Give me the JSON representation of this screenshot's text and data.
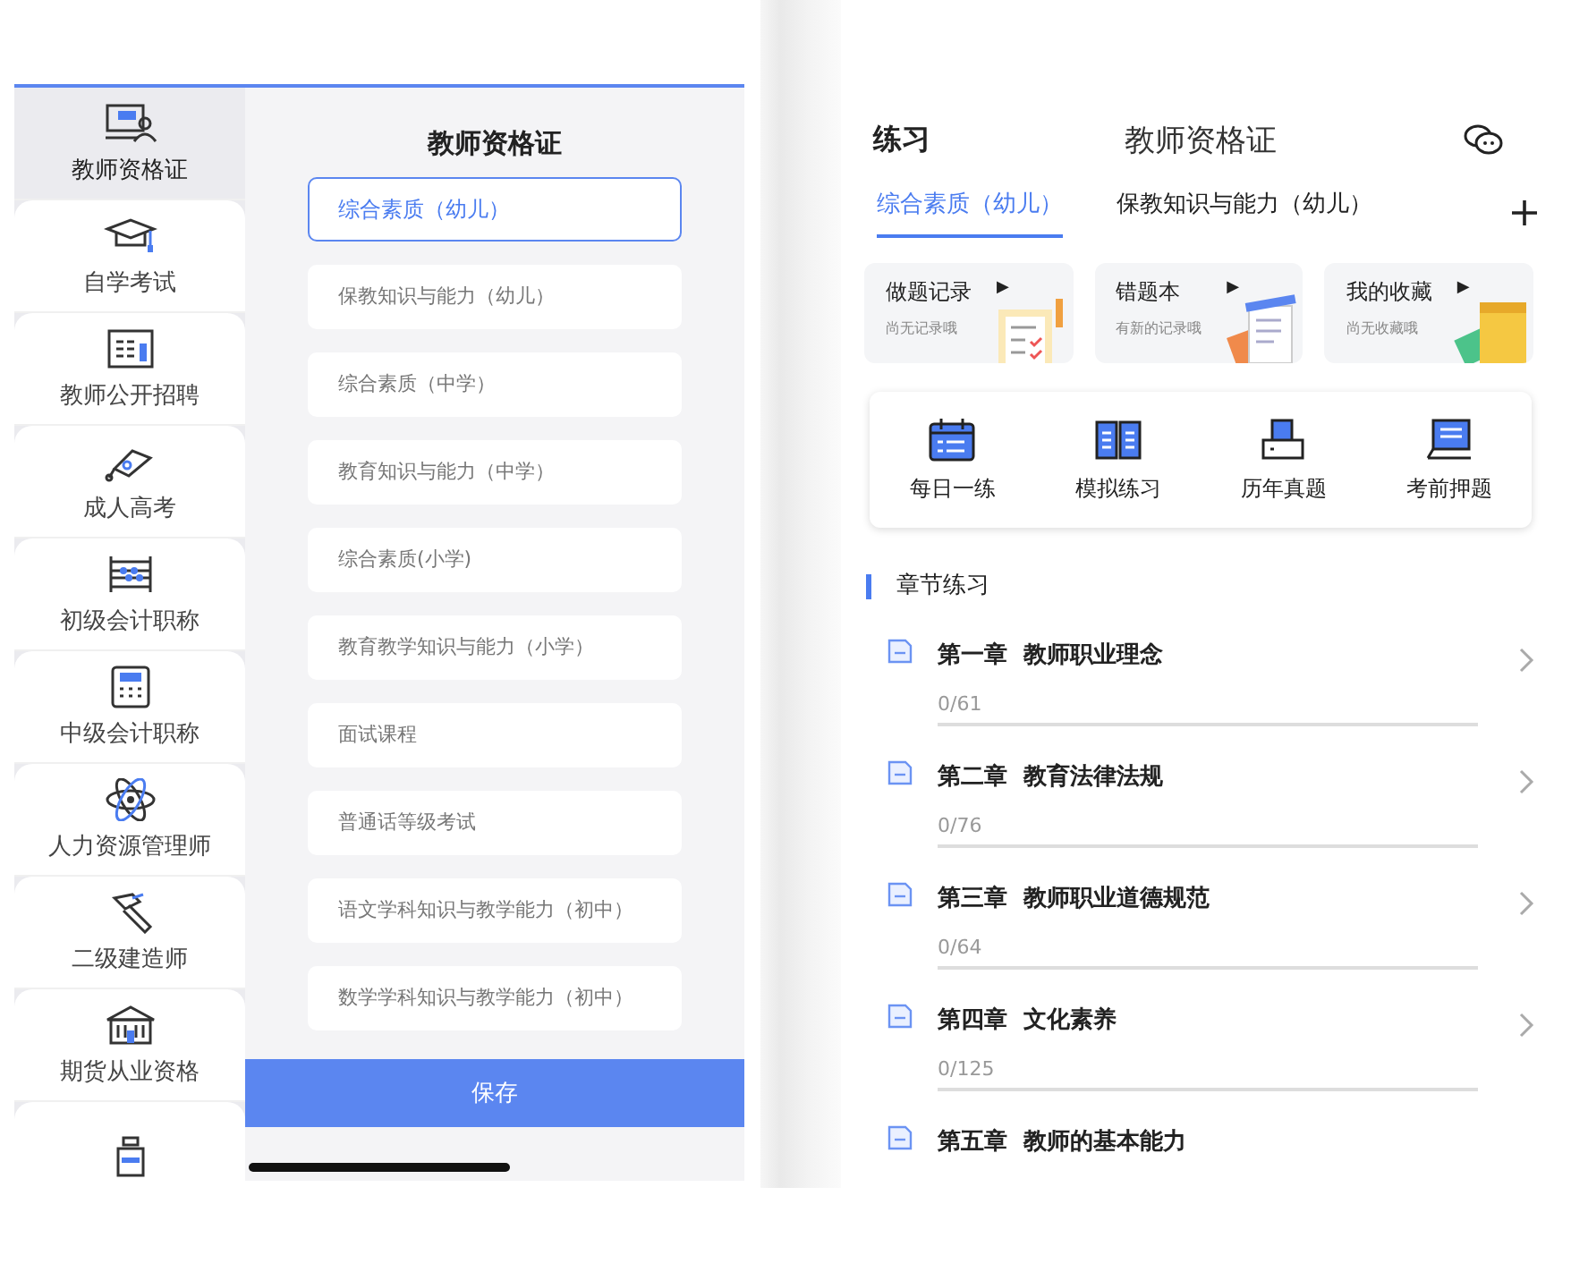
{
  "left_screen": {
    "sidebar": {
      "items": [
        {
          "label": "教师资格证",
          "selected": true
        },
        {
          "label": "自学考试",
          "selected": false
        },
        {
          "label": "教师公开招聘",
          "selected": false
        },
        {
          "label": "成人高考",
          "selected": false
        },
        {
          "label": "初级会计职称",
          "selected": false
        },
        {
          "label": "中级会计职称",
          "selected": false
        },
        {
          "label": "人力资源管理师",
          "selected": false
        },
        {
          "label": "二级建造师",
          "selected": false
        },
        {
          "label": "期货从业资格",
          "selected": false
        },
        {
          "selected": false
        }
      ]
    },
    "panel": {
      "title": "教师资格证",
      "options": [
        {
          "label": "综合素质（幼儿）",
          "selected": true
        },
        {
          "label": "保教知识与能力（幼儿）",
          "selected": false
        },
        {
          "label": "综合素质（中学）",
          "selected": false
        },
        {
          "label": "教育知识与能力（中学）",
          "selected": false
        },
        {
          "label": "综合素质(小学)",
          "selected": false
        },
        {
          "label": "教育教学知识与能力（小学）",
          "selected": false
        },
        {
          "label": "面试课程",
          "selected": false
        },
        {
          "label": "普通话等级考试",
          "selected": false
        },
        {
          "label": "语文学科知识与教学能力（初中）",
          "selected": false
        },
        {
          "label": "数学学科知识与教学能力（初中）",
          "selected": false
        }
      ],
      "save_button": "保存"
    }
  },
  "right_screen": {
    "header": {
      "left": "练习",
      "title": "教师资格证"
    },
    "tabs": [
      {
        "label": "综合素质（幼儿）",
        "selected": true
      },
      {
        "label": "保教知识与能力（幼儿）",
        "selected": false
      }
    ],
    "cards": [
      {
        "title": "做题记录",
        "arrow": "▶",
        "subtitle": "尚无记录哦"
      },
      {
        "title": "错题本",
        "arrow": "▶",
        "subtitle": "有新的记录哦"
      },
      {
        "title": "我的收藏",
        "arrow": "▶",
        "subtitle": "尚无收藏哦"
      }
    ],
    "shortcuts": [
      {
        "label": "每日一练"
      },
      {
        "label": "模拟练习"
      },
      {
        "label": "历年真题"
      },
      {
        "label": "考前押题"
      }
    ],
    "section": {
      "title": "章节练习"
    },
    "chapters": [
      {
        "title": "第一章  教师职业理念",
        "progress": "0/61",
        "level": 0
      },
      {
        "title": "第二章  教育法律法规",
        "progress": "0/76",
        "level": 0
      },
      {
        "title": "第三章  教师职业道德规范",
        "progress": "0/64",
        "level": 0
      },
      {
        "title": "第四章  文化素养",
        "progress": "0/125",
        "level": 0
      },
      {
        "title": "第五章  教师的基本能力"
      }
    ]
  }
}
